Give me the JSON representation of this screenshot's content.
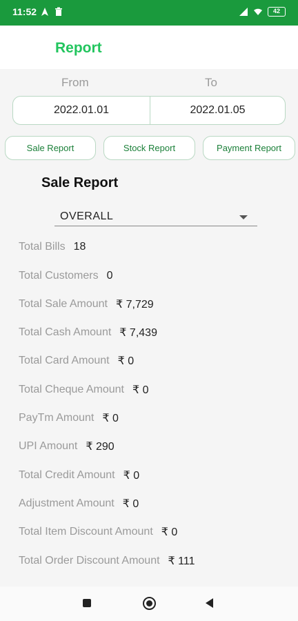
{
  "status_bar": {
    "time": "11:52",
    "battery": "42"
  },
  "app_bar": {
    "title": "Report"
  },
  "date_range": {
    "from_label": "From",
    "to_label": "To",
    "from_value": "2022.01.01",
    "to_value": "2022.01.05"
  },
  "tabs": [
    {
      "label": "Sale Report"
    },
    {
      "label": "Stock Report"
    },
    {
      "label": "Payment Report"
    }
  ],
  "section": {
    "title": "Sale Report"
  },
  "filter": {
    "selected": "OVERALL"
  },
  "stats": [
    {
      "label": "Total Bills",
      "value": "18"
    },
    {
      "label": "Total Customers",
      "value": "0"
    },
    {
      "label": "Total Sale Amount",
      "value": "₹ 7,729"
    },
    {
      "label": "Total Cash Amount",
      "value": "₹ 7,439"
    },
    {
      "label": "Total Card Amount",
      "value": "₹ 0"
    },
    {
      "label": "Total Cheque Amount",
      "value": "₹ 0"
    },
    {
      "label": "PayTm Amount",
      "value": "₹ 0"
    },
    {
      "label": "UPI Amount",
      "value": "₹ 290"
    },
    {
      "label": "Total Credit Amount",
      "value": "₹ 0"
    },
    {
      "label": "Adjustment Amount",
      "value": "₹ 0"
    },
    {
      "label": "Total Item Discount Amount",
      "value": "₹ 0"
    },
    {
      "label": "Total Order Discount Amount",
      "value": "₹ 111"
    }
  ],
  "colors": {
    "status_bar": "#1a9a3d",
    "accent": "#22c55e",
    "tab_text": "#1a7f38"
  },
  "icons": [
    "navigation-icon",
    "trash-icon",
    "signal-icon",
    "wifi-icon",
    "battery-icon",
    "dropdown-arrow-icon",
    "recent-apps-icon",
    "home-icon",
    "back-icon"
  ]
}
